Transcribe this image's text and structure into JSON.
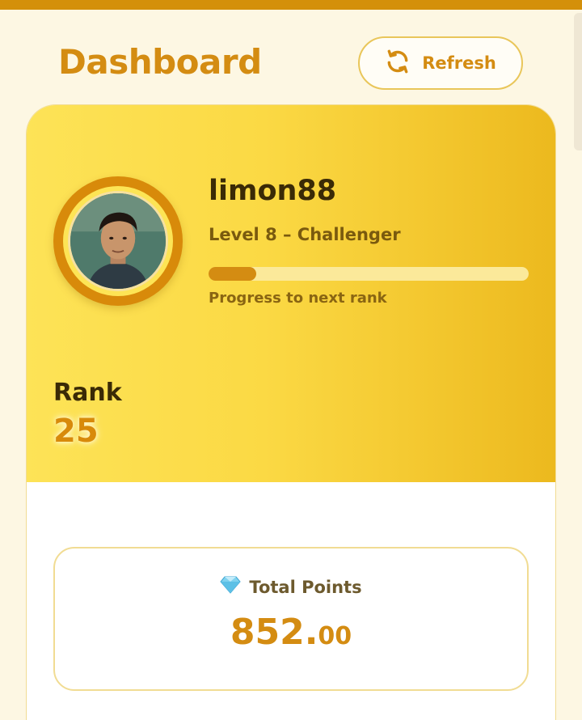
{
  "header": {
    "title": "Dashboard",
    "refresh_label": "Refresh"
  },
  "profile": {
    "username": "limon88",
    "level": "Level 8 – Challenger",
    "progress_fraction": 0.15,
    "progress_label": "Progress to next rank",
    "rank_label": "Rank",
    "rank_value": "25"
  },
  "points": {
    "label": "Total Points",
    "value_int": "852.",
    "value_dec": "00",
    "icon": "diamond-icon"
  },
  "colors": {
    "accent": "#d48c12",
    "hero_gradient_start": "#fde357",
    "hero_gradient_end": "#ecb91e",
    "background": "#fdf7e3"
  }
}
